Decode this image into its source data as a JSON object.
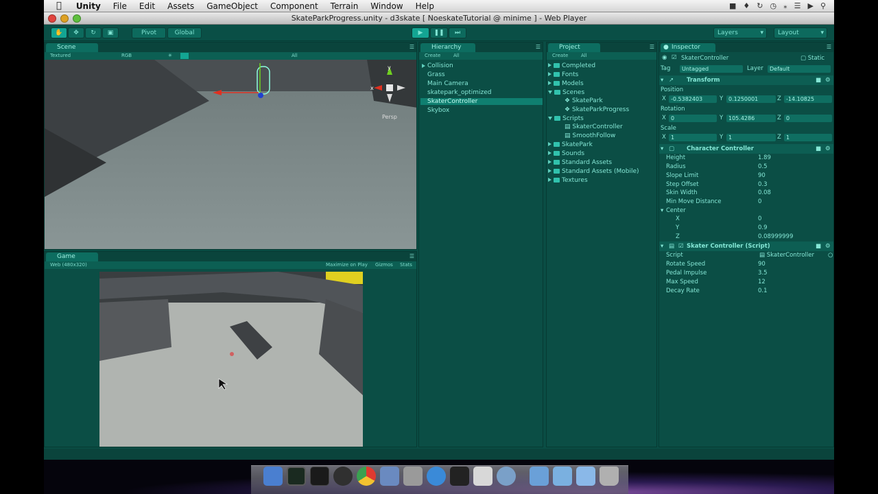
{
  "menubar": {
    "app": "Unity",
    "items": [
      "File",
      "Edit",
      "Assets",
      "GameObject",
      "Component",
      "Terrain",
      "Window",
      "Help"
    ]
  },
  "window": {
    "title": "SkateParkProgress.unity - d3skate [ NoeskateTutorial @ minime ] - Web Player"
  },
  "toolbar": {
    "pivot": "Pivot",
    "global": "Global",
    "layers": "Layers",
    "layout": "Layout"
  },
  "scene": {
    "tab": "Scene",
    "shading": "Textured",
    "channel": "RGB",
    "search": "All",
    "persp": "Persp",
    "gizmo_x": "x",
    "gizmo_y": "y"
  },
  "game": {
    "tab": "Game",
    "aspect": "Web (480x320)",
    "maximize": "Maximize on Play",
    "gizmos": "Gizmos",
    "stats": "Stats"
  },
  "hierarchy": {
    "tab": "Hierarchy",
    "create": "Create",
    "search": "All",
    "items": [
      {
        "label": "Collision",
        "expandable": true
      },
      {
        "label": "Grass",
        "expandable": false
      },
      {
        "label": "Main Camera",
        "expandable": false
      },
      {
        "label": "skatepark_optimized",
        "expandable": false
      },
      {
        "label": "SkaterController",
        "expandable": false,
        "selected": true
      },
      {
        "label": "Skybox",
        "expandable": false
      }
    ]
  },
  "project": {
    "tab": "Project",
    "create": "Create",
    "search": "All",
    "items": [
      {
        "label": "Completed",
        "type": "folder"
      },
      {
        "label": "Fonts",
        "type": "folder"
      },
      {
        "label": "Models",
        "type": "folder"
      },
      {
        "label": "Scenes",
        "type": "folder-open"
      },
      {
        "label": "SkatePark",
        "type": "scene"
      },
      {
        "label": "SkateParkProgress",
        "type": "scene"
      },
      {
        "label": "Scripts",
        "type": "folder-open"
      },
      {
        "label": "SkaterController",
        "type": "script"
      },
      {
        "label": "SmoothFollow",
        "type": "script"
      },
      {
        "label": "SkatePark",
        "type": "folder"
      },
      {
        "label": "Sounds",
        "type": "folder"
      },
      {
        "label": "Standard Assets",
        "type": "folder"
      },
      {
        "label": "Standard Assets (Mobile)",
        "type": "folder"
      },
      {
        "label": "Textures",
        "type": "folder"
      }
    ]
  },
  "inspector": {
    "tab": "Inspector",
    "object_name": "SkaterController",
    "static": "Static",
    "tag_label": "Tag",
    "tag": "Untagged",
    "layer_label": "Layer",
    "layer": "Default",
    "transform": {
      "title": "Transform",
      "position_label": "Position",
      "rotation_label": "Rotation",
      "scale_label": "Scale",
      "position": {
        "x": "-0.5382403",
        "y": "0.1250001",
        "z": "-14.10825"
      },
      "rotation": {
        "x": "0",
        "y": "105.4286",
        "z": "0"
      },
      "scale": {
        "x": "1",
        "y": "1",
        "z": "1"
      }
    },
    "character_controller": {
      "title": "Character Controller",
      "fields": [
        {
          "label": "Height",
          "value": "1.89"
        },
        {
          "label": "Radius",
          "value": "0.5"
        },
        {
          "label": "Slope Limit",
          "value": "90"
        },
        {
          "label": "Step Offset",
          "value": "0.3"
        },
        {
          "label": "Skin Width",
          "value": "0.08"
        },
        {
          "label": "Min Move Distance",
          "value": "0"
        }
      ],
      "center_label": "Center",
      "center": [
        {
          "label": "X",
          "value": "0"
        },
        {
          "label": "Y",
          "value": "0.9"
        },
        {
          "label": "Z",
          "value": "0.08999999"
        }
      ]
    },
    "skater_script": {
      "title": "Skater Controller (Script)",
      "script_label": "Script",
      "script_value": "SkaterController",
      "fields": [
        {
          "label": "Rotate Speed",
          "value": "90"
        },
        {
          "label": "Pedal Impulse",
          "value": "3.5"
        },
        {
          "label": "Max Speed",
          "value": "12"
        },
        {
          "label": "Decay Rate",
          "value": "0.1"
        }
      ]
    }
  },
  "colors": {
    "editor_bg": "#0a4d44",
    "accent": "#13a593",
    "text": "#84e6d5",
    "selection": "#0f7f70"
  }
}
